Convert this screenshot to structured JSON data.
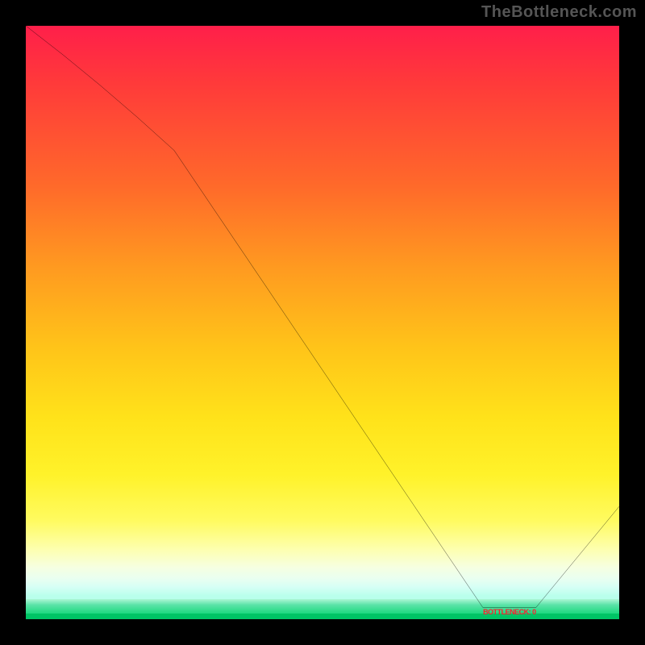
{
  "watermark": "TheBottleneck.com",
  "colors": {
    "background": "#000000",
    "curve": "#000000",
    "label": "#ff1e2d",
    "gradient_top": "#ff1f4a",
    "gradient_bottom": "#1ed97f"
  },
  "chart_data": {
    "type": "line",
    "title": "",
    "xlabel": "",
    "ylabel": "",
    "x_range": [
      0,
      100
    ],
    "y_range": [
      0,
      100
    ],
    "series": [
      {
        "name": "bottleneck-curve",
        "points": [
          {
            "x": 0,
            "y": 100
          },
          {
            "x": 25,
            "y": 79
          },
          {
            "x": 77,
            "y": 2
          },
          {
            "x": 86,
            "y": 2
          },
          {
            "x": 100,
            "y": 19
          }
        ]
      }
    ],
    "minimum_region": {
      "x_start": 77,
      "x_end": 86,
      "y": 2
    },
    "annotations": [
      {
        "text": "BOTTLENECK: 0",
        "x": 81.5,
        "y": 2
      }
    ],
    "gradient_meaning": "vertical color gradient red (high bottleneck) → yellow → green (low bottleneck)"
  }
}
